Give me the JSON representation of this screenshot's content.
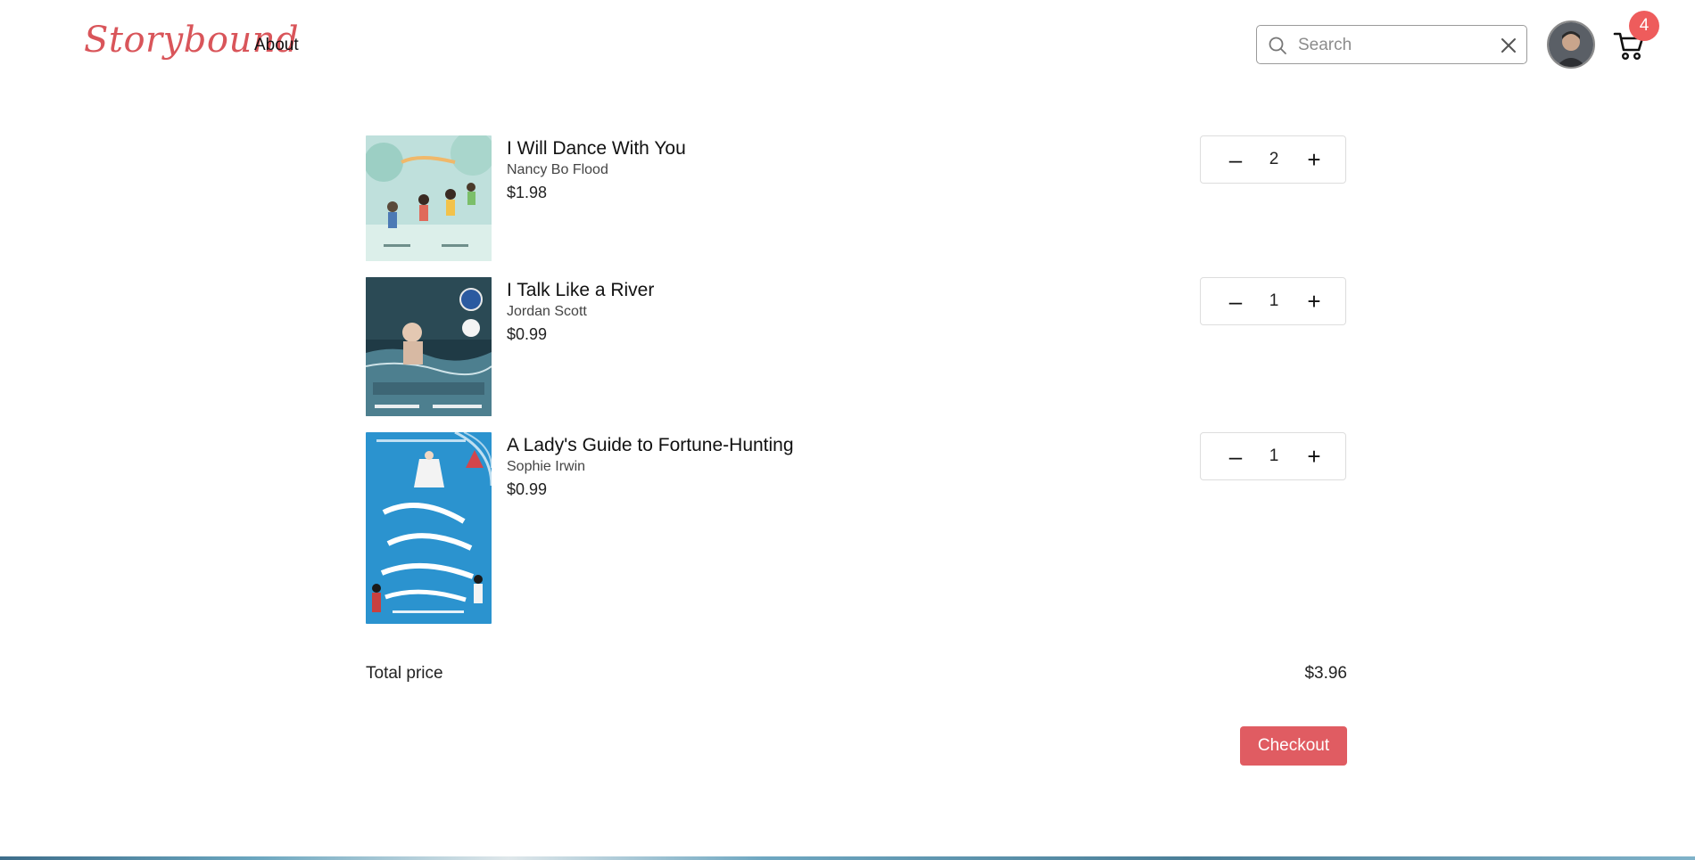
{
  "header": {
    "logo": "Storybound",
    "nav": {
      "about": "About"
    },
    "search": {
      "placeholder": "Search",
      "value": ""
    },
    "cart_count": "4"
  },
  "cart": {
    "items": [
      {
        "title": "I Will Dance With You",
        "author": "Nancy Bo Flood",
        "price": "$1.98",
        "quantity": "2"
      },
      {
        "title": "I Talk Like a River",
        "author": "Jordan Scott",
        "price": "$0.99",
        "quantity": "1"
      },
      {
        "title": "A Lady's Guide to Fortune-Hunting",
        "author": "Sophie Irwin",
        "price": "$0.99",
        "quantity": "1"
      }
    ],
    "stepper": {
      "minus": "–",
      "plus": "+"
    },
    "total_label": "Total price",
    "total_value": "$3.96",
    "checkout_label": "Checkout"
  },
  "colors": {
    "brand": "#d9555a",
    "checkout": "#e05c62",
    "badge": "#ee5c5c"
  }
}
